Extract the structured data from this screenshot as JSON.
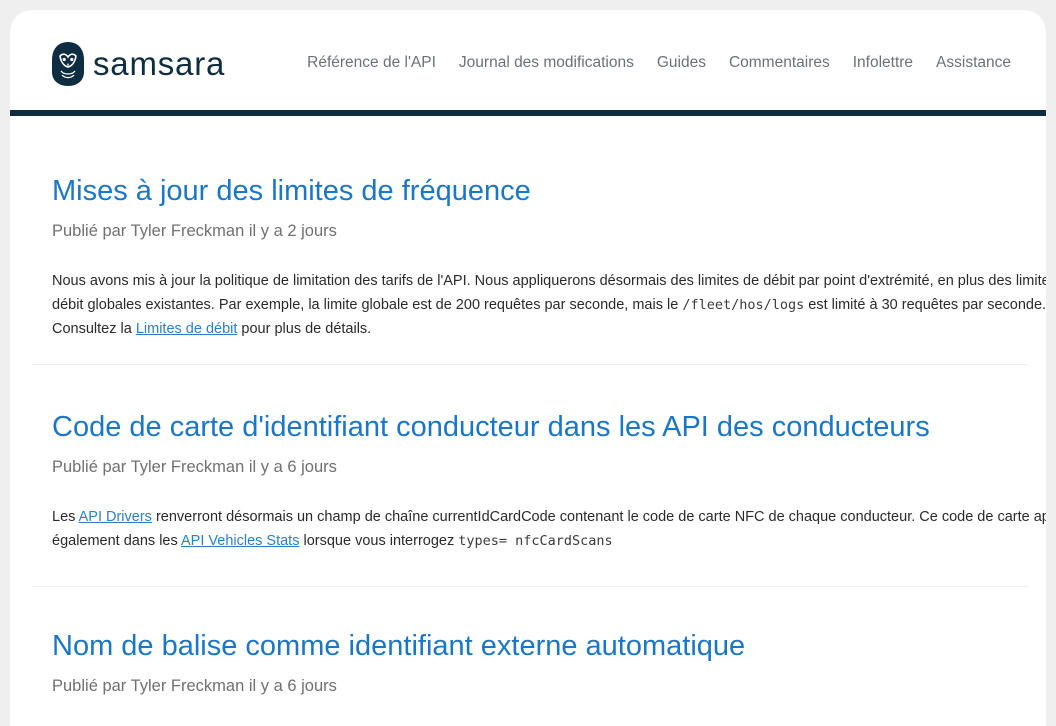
{
  "brand": {
    "name": "samsara",
    "color": "#0f2d40"
  },
  "nav": {
    "items": [
      "Référence de l'API",
      "Journal des modifications",
      "Guides",
      "Commentaires",
      "Infolettre",
      "Assistance"
    ]
  },
  "posts": [
    {
      "title": "Mises à jour des limites de fréquence",
      "meta": "Publié par Tyler Freckman il y a 2 jours",
      "body": {
        "p1": "Nous avons mis à jour la politique de limitation des tarifs de l'API. Nous appliquerons désormais des limites de débit par point d'extrémité, en plus des limites de débit globales existantes. Par exemple, la limite globale est de 200 requêtes par seconde, mais le ",
        "code1": "/fleet/hos/logs",
        "p2": " est limité à 30 requêtes par seconde. Consultez la ",
        "link1": "Limites de débit",
        "p3": " pour plus de détails."
      }
    },
    {
      "title": "Code de carte d'identifiant conducteur dans les API des conducteurs",
      "meta": "Publié par Tyler Freckman il y a 6 jours",
      "body": {
        "p1": "Les ",
        "link1": "API Drivers",
        "p2": " renverront désormais un champ de chaîne currentIdCardCode contenant le code de carte NFC de chaque conducteur. Ce code de carte apparaît également dans les ",
        "link2": "API Vehicles Stats",
        "p3": " lorsque vous interrogez ",
        "code1": "types= nfcCardScans"
      }
    },
    {
      "title": "Nom de balise comme identifiant externe automatique",
      "meta": "Publié par Tyler Freckman il y a 6 jours"
    }
  ],
  "colors": {
    "title": "#1b76c5",
    "link": "#2b7fc6",
    "meta": "#707070",
    "header_border": "#0f2d40"
  },
  "icons": {
    "logo": "owl-logo-icon"
  }
}
